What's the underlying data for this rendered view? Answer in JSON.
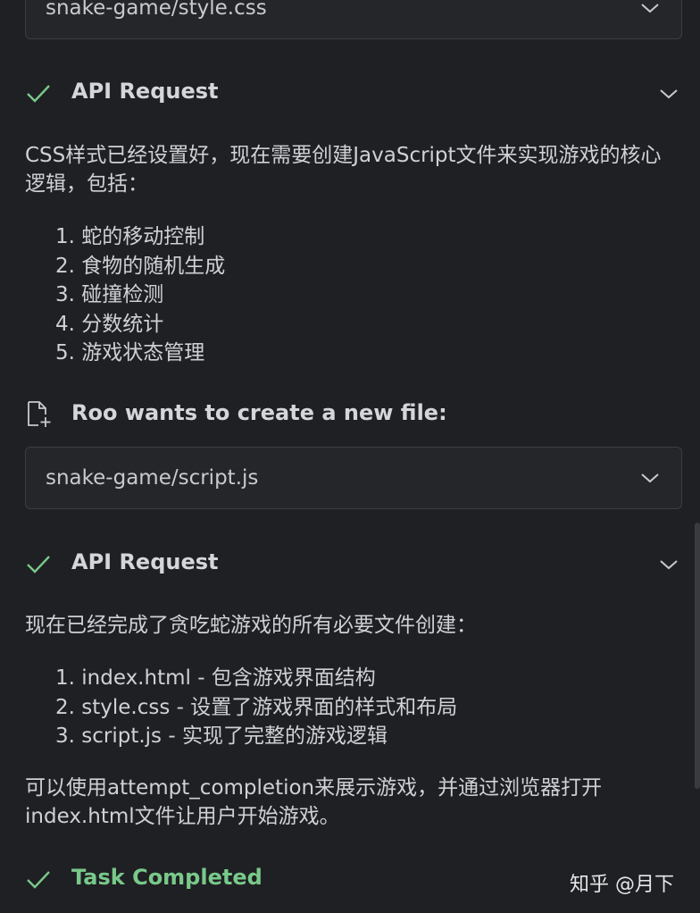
{
  "colors": {
    "background": "#1f2023",
    "check_green": "#79c98a",
    "text": "#cfd1d4"
  },
  "file_box_top": {
    "path": "snake-game/style.css"
  },
  "api_request_1": {
    "title": "API Request",
    "intro": "CSS样式已经设置好，现在需要创建JavaScript文件来实现游戏的核心逻辑，包括：",
    "items": [
      "1. 蛇的移动控制",
      "2. 食物的随机生成",
      "3. 碰撞检测",
      "4. 分数统计",
      "5. 游戏状态管理"
    ]
  },
  "create_file": {
    "title": "Roo wants to create a new file:",
    "path": "snake-game/script.js"
  },
  "api_request_2": {
    "title": "API Request",
    "intro": "现在已经完成了贪吃蛇游戏的所有必要文件创建：",
    "items": [
      "1. index.html - 包含游戏界面结构",
      "2. style.css - 设置了游戏界面的样式和布局",
      "3. script.js - 实现了完整的游戏逻辑"
    ],
    "outro": "可以使用attempt_completion来展示游戏，并通过浏览器打开index.html文件让用户开始游戏。"
  },
  "task_completed": {
    "title": "Task Completed"
  },
  "watermark": "知乎 @月下"
}
